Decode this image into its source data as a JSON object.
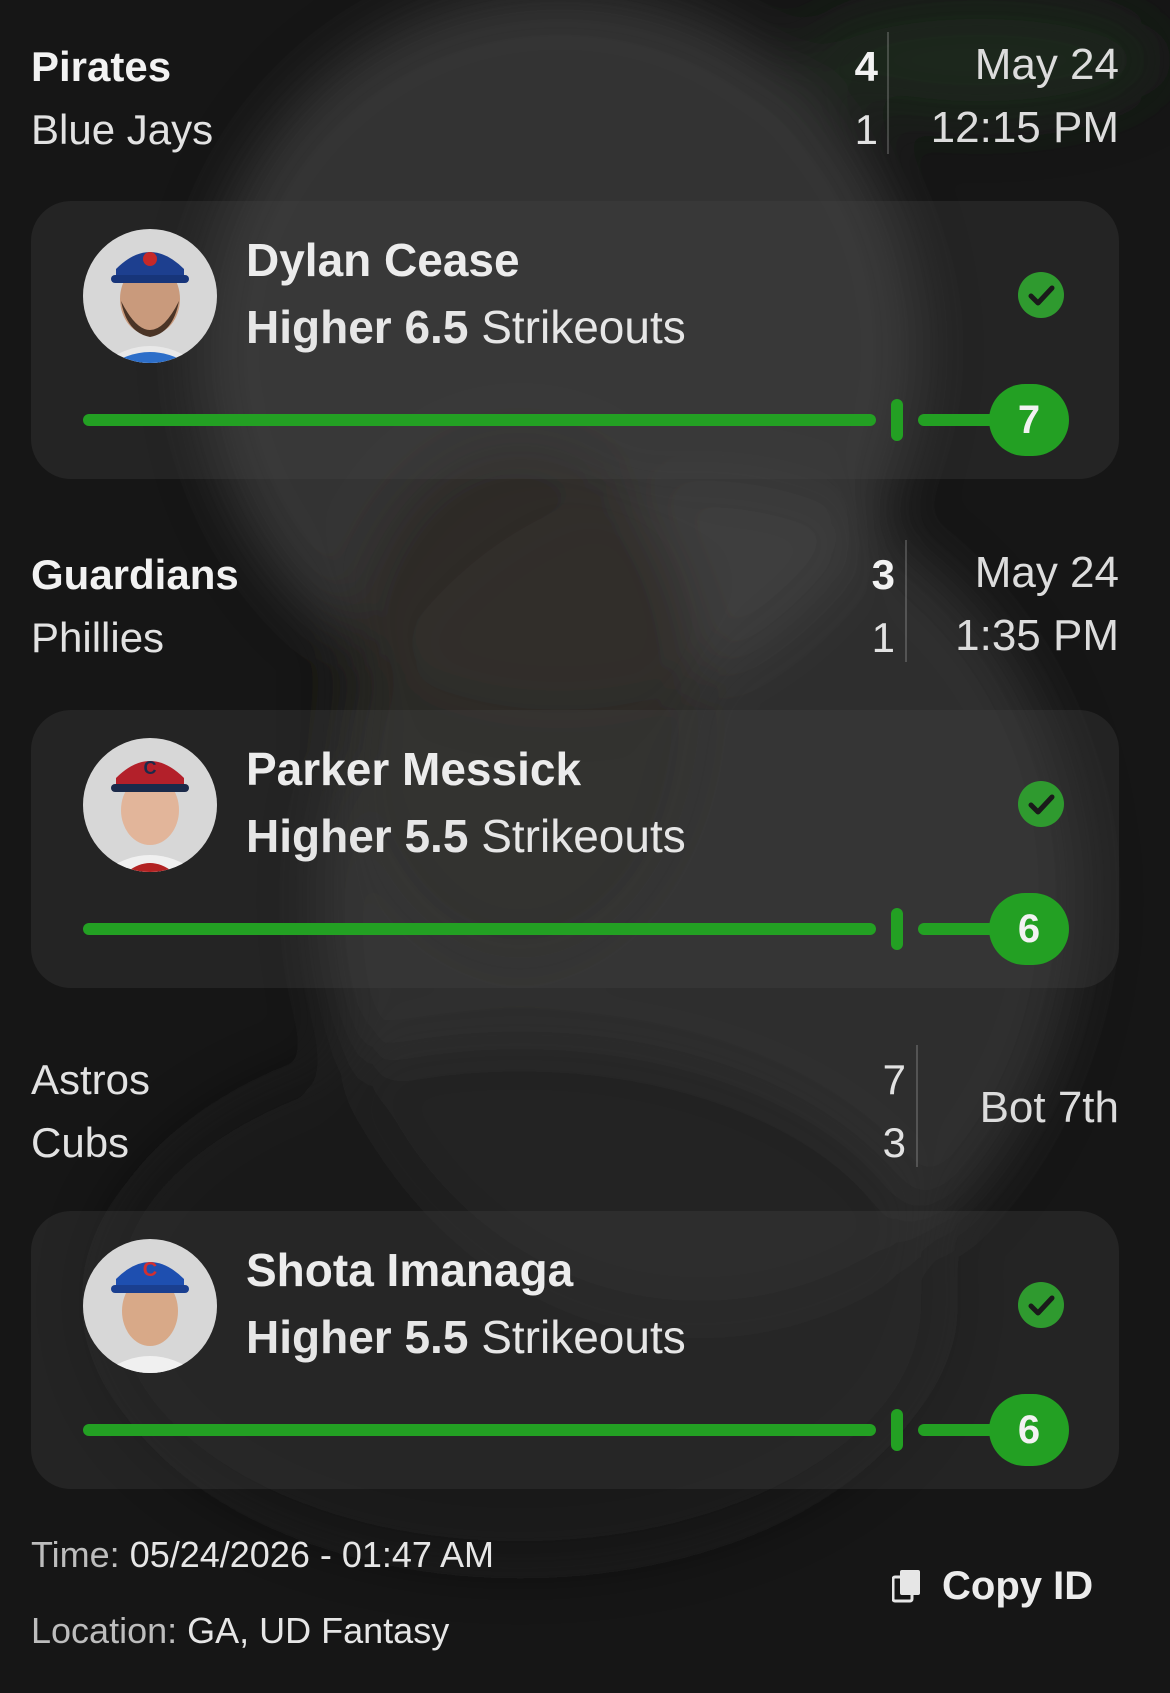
{
  "games": [
    {
      "team1": "Pirates",
      "score1": "4",
      "team2": "Blue Jays",
      "score2": "1",
      "when1": "May 24",
      "when2": "12:15 PM",
      "pick": {
        "player": "Dylan Cease",
        "direction": "Higher",
        "line": "6.5",
        "stat": "Strikeouts",
        "result": "7",
        "result_fraction": 1.0,
        "status": "won"
      }
    },
    {
      "team1": "Guardians",
      "score1": "3",
      "team2": "Phillies",
      "score2": "1",
      "when1": "May 24",
      "when2": "1:35 PM",
      "pick": {
        "player": "Parker Messick",
        "direction": "Higher",
        "line": "5.5",
        "stat": "Strikeouts",
        "result": "6",
        "result_fraction": 1.0,
        "status": "won"
      }
    },
    {
      "team1": "Astros",
      "score1": "7",
      "team2": "Cubs",
      "score2": "3",
      "status": "Bot 7th",
      "pick": {
        "player": "Shota Imanaga",
        "direction": "Higher",
        "line": "5.5",
        "stat": "Strikeouts",
        "result": "6",
        "result_fraction": 1.0,
        "status": "won"
      }
    }
  ],
  "footer": {
    "time_label": "Time:",
    "time_value": "05/24/2026 - 01:47 AM",
    "location_label": "Location:",
    "location_value": "GA, UD Fantasy",
    "copy_label": "Copy ID"
  },
  "colors": {
    "accent": "#23a023",
    "background": "#141414"
  },
  "icons": {
    "check": "check-circle-icon",
    "copy": "copy-icon"
  }
}
